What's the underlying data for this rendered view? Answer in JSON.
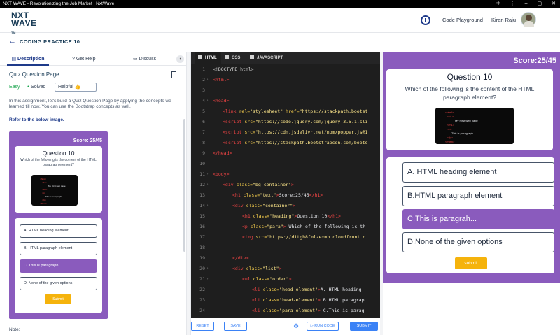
{
  "window": {
    "title": "NXT WAVE - Revolutionizing the Job Market | NxtWave"
  },
  "header": {
    "logo_line1": "NXT",
    "logo_line2": "WAVE",
    "logo_tm": "TM",
    "code_playground": "Code Playground",
    "user_name": "Kiran Raju"
  },
  "breadcrumb": {
    "title": "CODING PRACTICE 10"
  },
  "left_tabs": [
    {
      "label": "Description"
    },
    {
      "label": "Get Help"
    },
    {
      "label": "Discuss"
    }
  ],
  "problem": {
    "title": "Quiz Question Page",
    "difficulty": "Easy",
    "status": "Solved",
    "helpful": "Helpful",
    "description": "In this assignment, let's build a Quiz Question Page by applying the concepts we learned till now. You can use the Bootstrap concepts as well.",
    "refer": "Refer to the below image.",
    "note": "Note:"
  },
  "reference": {
    "score": "Score: 25/45",
    "heading": "Question 10",
    "question": "Which of the following is the content of the HTML paragraph element?",
    "options": [
      "A. HTML heading element",
      "B. HTML paragraph element",
      "C. This is paragraph...",
      "D. None of the given options"
    ],
    "selected": 2,
    "submit": "Submit",
    "code_lines": [
      "<html>",
      "<h1>",
      "My First web page",
      "</h1>",
      "<p>",
      "This is paragraph...",
      "</p>",
      "</html>"
    ]
  },
  "editor": {
    "tabs": [
      {
        "label": "HTML"
      },
      {
        "label": "CSS"
      },
      {
        "label": "JAVASCRIPT"
      }
    ],
    "buttons": {
      "reset": "RESET",
      "save": "SAVE",
      "run": "RUN CODE",
      "submit": "SUBMIT"
    }
  },
  "preview": {
    "score": "Score:25/45",
    "heading": "Question 10",
    "question": "Which of the following is the content of the HTML paragraph element?",
    "options": [
      "A. HTML heading element",
      "B.HTML paragraph element",
      "C.This is paragrah...",
      "D.None of the given options"
    ],
    "selected": 2,
    "submit": "submit",
    "code_lines": [
      "<html>",
      "<h1>",
      "My First web page",
      "</h1>",
      "<p>",
      "This is paragraph...",
      "</p>",
      "</html>"
    ]
  },
  "colors": {
    "accent": "#8a5bbd",
    "submit": "#f5b30c",
    "brand": "#1e3a8a"
  }
}
